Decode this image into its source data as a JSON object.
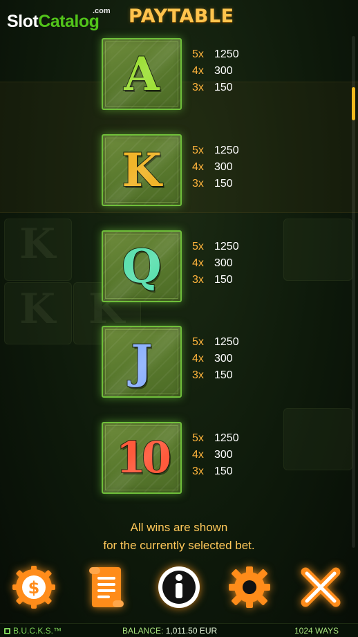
{
  "header": {
    "logo_slot": "Slot",
    "logo_catalog": "Catalog",
    "logo_com": ".com",
    "title": "PAYTABLE"
  },
  "symbols": [
    {
      "glyph": "A",
      "pays": [
        {
          "mult": "5x",
          "value": "1250"
        },
        {
          "mult": "4x",
          "value": "300"
        },
        {
          "mult": "3x",
          "value": "150"
        }
      ]
    },
    {
      "glyph": "K",
      "pays": [
        {
          "mult": "5x",
          "value": "1250"
        },
        {
          "mult": "4x",
          "value": "300"
        },
        {
          "mult": "3x",
          "value": "150"
        }
      ]
    },
    {
      "glyph": "Q",
      "pays": [
        {
          "mult": "5x",
          "value": "1250"
        },
        {
          "mult": "4x",
          "value": "300"
        },
        {
          "mult": "3x",
          "value": "150"
        }
      ]
    },
    {
      "glyph": "J",
      "pays": [
        {
          "mult": "5x",
          "value": "1250"
        },
        {
          "mult": "4x",
          "value": "300"
        },
        {
          "mult": "3x",
          "value": "150"
        }
      ]
    },
    {
      "glyph": "10",
      "pays": [
        {
          "mult": "5x",
          "value": "1250"
        },
        {
          "mult": "4x",
          "value": "300"
        },
        {
          "mult": "3x",
          "value": "150"
        }
      ]
    }
  ],
  "info": {
    "line1": "All wins are shown",
    "line2": "for the currently selected bet."
  },
  "buttons": {
    "icons": [
      "coin-dollar-icon",
      "scroll-icon",
      "info-icon",
      "gear-icon",
      "close-icon"
    ],
    "accent": "#ff8c1a"
  },
  "status": {
    "brand": "B.U.C.K.S.™",
    "balance_label": "BALANCE:",
    "balance_value": "1,011.50 EUR",
    "ways": "1024 WAYS"
  },
  "colors": {
    "title": "#ffc34d",
    "multiplier": "#ffb43c",
    "tile_border": "#6fbf3a",
    "scroll_thumb": "#f1b91f"
  }
}
